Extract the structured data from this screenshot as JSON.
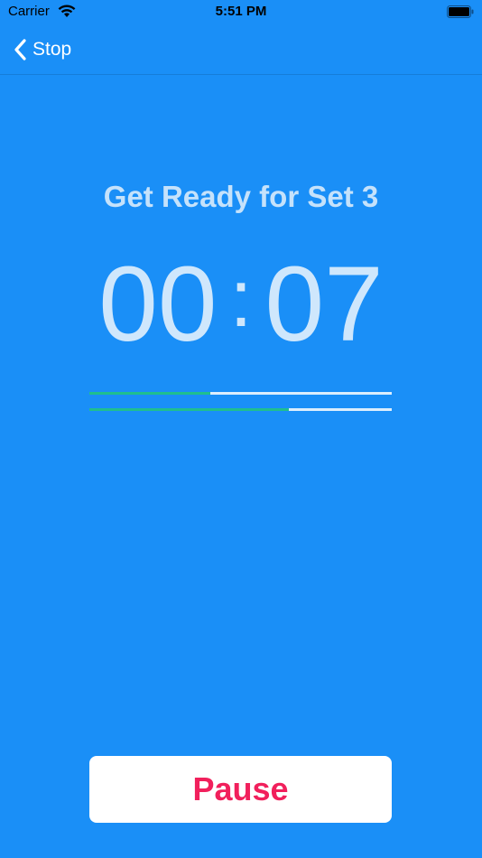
{
  "status_bar": {
    "carrier": "Carrier",
    "time": "5:51 PM",
    "wifi_icon": "wifi-icon",
    "battery_icon": "battery-icon"
  },
  "nav": {
    "back_label": "Stop",
    "back_icon": "chevron-left-icon"
  },
  "workout": {
    "title": "Get Ready for Set 3",
    "minutes": "00",
    "seconds": "07",
    "separator": ":",
    "progress_1": 0.4,
    "progress_2": 0.66
  },
  "actions": {
    "pause_label": "Pause"
  },
  "colors": {
    "background": "#1a8ff7",
    "progress_fill": "#1fbf8f",
    "progress_track": "#dceefd",
    "pause_text": "#f1205c"
  }
}
